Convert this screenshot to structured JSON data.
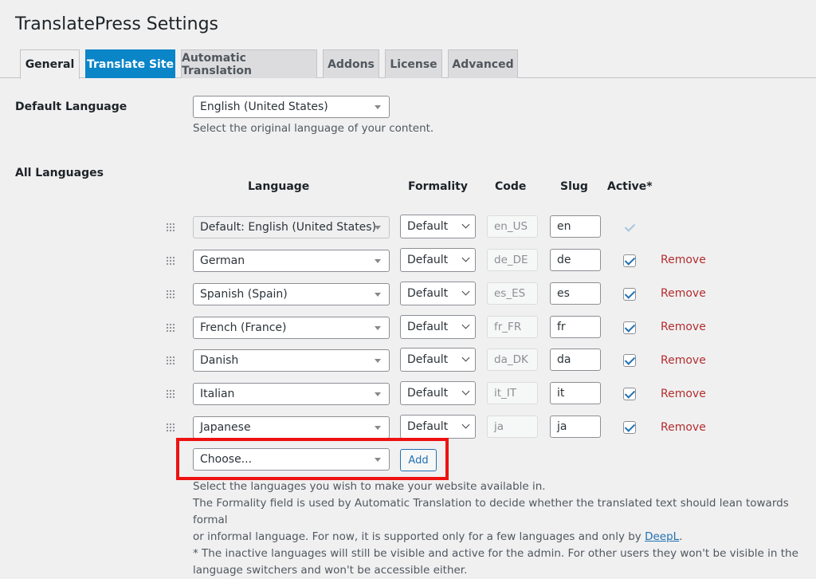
{
  "page_title": "TranslatePress Settings",
  "tabs": [
    {
      "label": "General"
    },
    {
      "label": "Translate Site"
    },
    {
      "label": "Automatic Translation"
    },
    {
      "label": "Addons"
    },
    {
      "label": "License"
    },
    {
      "label": "Advanced"
    }
  ],
  "default_language": {
    "label": "Default Language",
    "value": "English (United States)",
    "description": "Select the original language of your content."
  },
  "all_languages": {
    "label": "All Languages",
    "columns": {
      "language": "Language",
      "formality": "Formality",
      "code": "Code",
      "slug": "Slug",
      "active": "Active*"
    },
    "rows": [
      {
        "language": "Default: English (United States)",
        "formality": "Default",
        "code": "en_US",
        "slug": "en",
        "active": true,
        "removable": false
      },
      {
        "language": "German",
        "formality": "Default",
        "code": "de_DE",
        "slug": "de",
        "active": true,
        "removable": true
      },
      {
        "language": "Spanish (Spain)",
        "formality": "Default",
        "code": "es_ES",
        "slug": "es",
        "active": true,
        "removable": true
      },
      {
        "language": "French (France)",
        "formality": "Default",
        "code": "fr_FR",
        "slug": "fr",
        "active": true,
        "removable": true
      },
      {
        "language": "Danish",
        "formality": "Default",
        "code": "da_DK",
        "slug": "da",
        "active": true,
        "removable": true
      },
      {
        "language": "Italian",
        "formality": "Default",
        "code": "it_IT",
        "slug": "it",
        "active": true,
        "removable": true
      },
      {
        "language": "Japanese",
        "formality": "Default",
        "code": "ja",
        "slug": "ja",
        "active": true,
        "removable": true
      }
    ],
    "remove_label": "Remove",
    "choose_placeholder": "Choose...",
    "add_label": "Add",
    "help": {
      "line1": "Select the languages you wish to make your website available in.",
      "line2": "The Formality field is used by Automatic Translation to decide whether the translated text should lean towards formal",
      "line3_pre": "or informal language. For now, it is supported only for a few languages and only by ",
      "line3_link": "DeepL",
      "line3_post": ".",
      "line4": "* The inactive languages will still be visible and active for the admin. For other users they won't be visible in the",
      "line5": "language switchers and won't be accessible either."
    }
  },
  "colors": {
    "accent": "#0a85c8",
    "remove": "#b32d2e",
    "highlight_box": "#ee1111"
  }
}
